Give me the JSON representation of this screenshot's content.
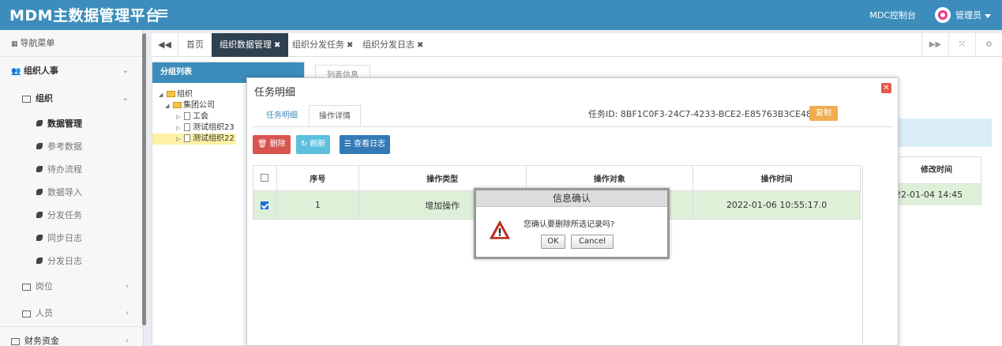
{
  "header": {
    "app_title": "MDM主数据管理平台",
    "mdc_label": "MDC控制台",
    "user_label": "管理员"
  },
  "sidebar": {
    "nav_title": "导航菜单",
    "group_org": "组织人事",
    "sub_org": "组织",
    "leaves": [
      "数据管理",
      "参考数据",
      "待办流程",
      "数据导入",
      "分发任务",
      "同步日志",
      "分发日志"
    ],
    "sub_position": "岗位",
    "sub_people": "人员",
    "group_finance": "财务资金"
  },
  "tabs": {
    "home": "首页",
    "t1": "组织数据管理",
    "t2": "组织分发任务",
    "t3": "组织分发日志"
  },
  "left_panel": {
    "title": "分组列表",
    "tree": {
      "root": "组织",
      "company": "集团公司",
      "c1": "工会",
      "c2": "测试组织23",
      "c3": "测试组织22"
    }
  },
  "background": {
    "list_tab": "列表信息",
    "col_modified": "修改时间",
    "row_modified": "22-01-04 14:45"
  },
  "modal": {
    "title": "任务明细",
    "tab_detail": "任务明细",
    "tab_ops": "操作详情",
    "task_id": "任务ID: 8BF1C0F3-24C7-4233-BCE2-E85763B3CE48",
    "copy_btn": "复制",
    "btn_delete": "删除",
    "btn_refresh": "刷新",
    "btn_log": "查看日志",
    "columns": {
      "seq": "序号",
      "op_type": "操作类型",
      "op_target": "操作对象",
      "op_time": "操作时间"
    },
    "row": {
      "seq": "1",
      "op_type": "增加操作",
      "op_target": "",
      "op_time": "2022-01-06 10:55:17.0"
    }
  },
  "confirm": {
    "title": "信息确认",
    "message": "您确认要删除所选记录吗?",
    "ok": "OK",
    "cancel": "Cancel"
  },
  "colors": {
    "primary": "#3c8dbc",
    "danger": "#d9534f",
    "info": "#5bc0de",
    "warning": "#f0ad4e",
    "selected_row": "#dff0d8"
  }
}
